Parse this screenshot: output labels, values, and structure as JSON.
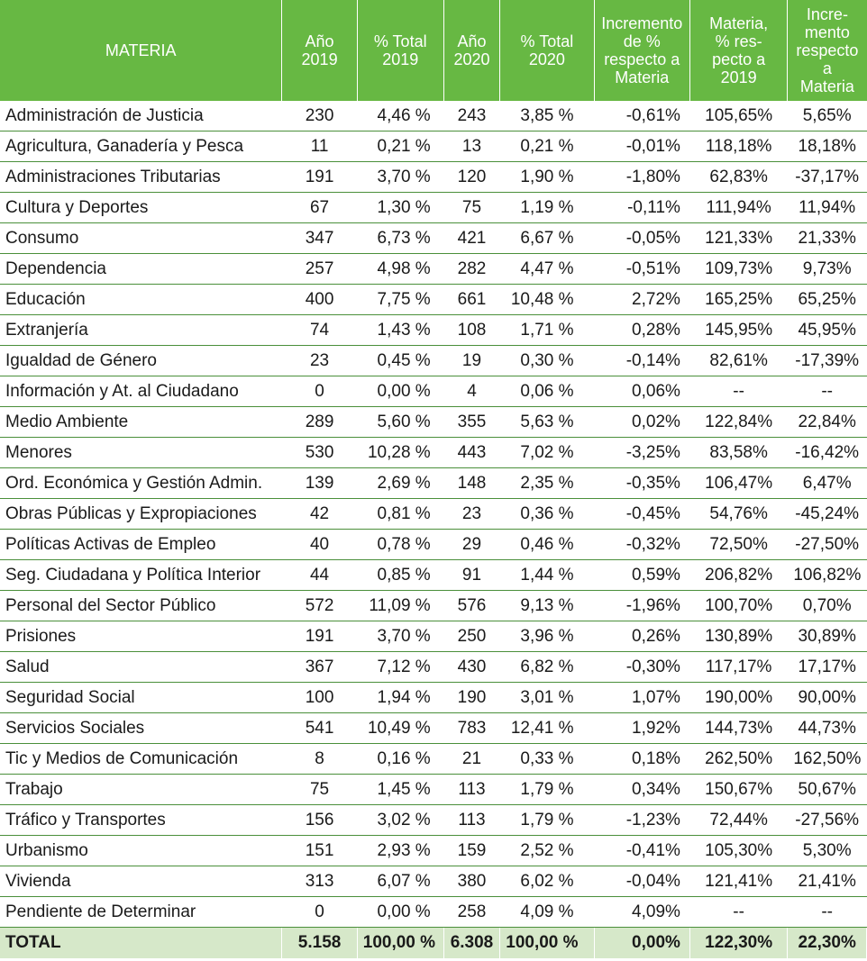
{
  "table": {
    "headers": [
      [
        "MATERIA"
      ],
      [
        "Año",
        "2019"
      ],
      [
        "% Total",
        "2019"
      ],
      [
        "Año",
        "2020"
      ],
      [
        "% Total",
        "2020"
      ],
      [
        "Incremento",
        "de %",
        "respecto a",
        "Materia"
      ],
      [
        "Materia,",
        "% res-",
        "pecto a",
        "2019"
      ],
      [
        "Incre-",
        "mento",
        "respecto a",
        "Materia"
      ]
    ],
    "rows": [
      [
        "Administración de Justicia",
        "230",
        "4,46 %",
        "243",
        "3,85 %",
        "-0,61%",
        "105,65%",
        "5,65%"
      ],
      [
        "Agricultura, Ganadería y Pesca",
        "11",
        "0,21 %",
        "13",
        "0,21 %",
        "-0,01%",
        "118,18%",
        "18,18%"
      ],
      [
        "Administraciones Tributarias",
        "191",
        "3,70 %",
        "120",
        "1,90 %",
        "-1,80%",
        "62,83%",
        "-37,17%"
      ],
      [
        "Cultura y Deportes",
        "67",
        "1,30 %",
        "75",
        "1,19 %",
        "-0,11%",
        "111,94%",
        "11,94%"
      ],
      [
        "Consumo",
        "347",
        "6,73 %",
        "421",
        "6,67 %",
        "-0,05%",
        "121,33%",
        "21,33%"
      ],
      [
        "Dependencia",
        "257",
        "4,98 %",
        "282",
        "4,47 %",
        "-0,51%",
        "109,73%",
        "9,73%"
      ],
      [
        "Educación",
        "400",
        "7,75 %",
        "661",
        "10,48 %",
        "2,72%",
        "165,25%",
        "65,25%"
      ],
      [
        "Extranjería",
        "74",
        "1,43 %",
        "108",
        "1,71 %",
        "0,28%",
        "145,95%",
        "45,95%"
      ],
      [
        "Igualdad de Género",
        "23",
        "0,45 %",
        "19",
        "0,30 %",
        "-0,14%",
        "82,61%",
        "-17,39%"
      ],
      [
        "Información y At. al Ciudadano",
        "0",
        "0,00 %",
        "4",
        "0,06 %",
        "0,06%",
        "--",
        "--"
      ],
      [
        "Medio Ambiente",
        "289",
        "5,60 %",
        "355",
        "5,63 %",
        "0,02%",
        "122,84%",
        "22,84%"
      ],
      [
        "Menores",
        "530",
        "10,28 %",
        "443",
        "7,02 %",
        "-3,25%",
        "83,58%",
        "-16,42%"
      ],
      [
        "Ord. Económica y Gestión Admin.",
        "139",
        "2,69 %",
        "148",
        "2,35 %",
        "-0,35%",
        "106,47%",
        "6,47%"
      ],
      [
        "Obras Públicas y Expropiaciones",
        "42",
        "0,81 %",
        "23",
        "0,36 %",
        "-0,45%",
        "54,76%",
        "-45,24%"
      ],
      [
        "Políticas Activas de Empleo",
        "40",
        "0,78 %",
        "29",
        "0,46 %",
        "-0,32%",
        "72,50%",
        "-27,50%"
      ],
      [
        "Seg. Ciudadana y Política Interior",
        "44",
        "0,85 %",
        "91",
        "1,44 %",
        "0,59%",
        "206,82%",
        "106,82%"
      ],
      [
        "Personal del Sector Público",
        "572",
        "11,09 %",
        "576",
        "9,13 %",
        "-1,96%",
        "100,70%",
        "0,70%"
      ],
      [
        "Prisiones",
        "191",
        "3,70 %",
        "250",
        "3,96 %",
        "0,26%",
        "130,89%",
        "30,89%"
      ],
      [
        "Salud",
        "367",
        "7,12 %",
        "430",
        "6,82 %",
        "-0,30%",
        "117,17%",
        "17,17%"
      ],
      [
        "Seguridad Social",
        "100",
        "1,94 %",
        "190",
        "3,01 %",
        "1,07%",
        "190,00%",
        "90,00%"
      ],
      [
        "Servicios Sociales",
        "541",
        "10,49 %",
        "783",
        "12,41 %",
        "1,92%",
        "144,73%",
        "44,73%"
      ],
      [
        "Tic y Medios de Comunicación",
        "8",
        "0,16 %",
        "21",
        "0,33 %",
        "0,18%",
        "262,50%",
        "162,50%"
      ],
      [
        "Trabajo",
        "75",
        "1,45 %",
        "113",
        "1,79 %",
        "0,34%",
        "150,67%",
        "50,67%"
      ],
      [
        "Tráfico y Transportes",
        "156",
        "3,02 %",
        "113",
        "1,79 %",
        "-1,23%",
        "72,44%",
        "-27,56%"
      ],
      [
        "Urbanismo",
        "151",
        "2,93 %",
        "159",
        "2,52 %",
        "-0,41%",
        "105,30%",
        "5,30%"
      ],
      [
        "Vivienda",
        "313",
        "6,07 %",
        "380",
        "6,02 %",
        "-0,04%",
        "121,41%",
        "21,41%"
      ],
      [
        "Pendiente de Determinar",
        "0",
        "0,00 %",
        "258",
        "4,09 %",
        "4,09%",
        "--",
        "--"
      ]
    ],
    "total": [
      "TOTAL",
      "5.158",
      "100,00 %",
      "6.308",
      "100,00 %",
      "0,00%",
      "122,30%",
      "22,30%"
    ]
  },
  "colors": {
    "header_bg": "#67b843",
    "header_text": "#ffffff",
    "row_rule": "#4a8f3a",
    "total_bg": "#d6e8c9"
  }
}
